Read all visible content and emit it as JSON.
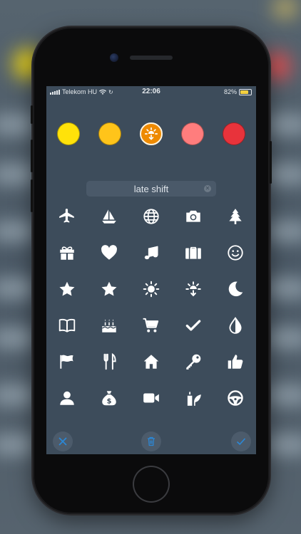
{
  "status_bar": {
    "carrier": "Telekom HU",
    "time": "22:06",
    "battery": "82%",
    "battery_level": 0.82
  },
  "colors": [
    {
      "name": "yellow",
      "hex": "#ffe20a",
      "selected": false
    },
    {
      "name": "amber",
      "hex": "#ffc41a",
      "selected": false
    },
    {
      "name": "orange",
      "hex": "#ee8a00",
      "selected": true
    },
    {
      "name": "salmon",
      "hex": "#ff7d7d",
      "selected": false
    },
    {
      "name": "red",
      "hex": "#e8333b",
      "selected": false
    }
  ],
  "shift_name": {
    "value": "late shift"
  },
  "icons": [
    [
      "airplane-icon",
      "sailboat-icon",
      "globe-icon",
      "camera-icon",
      "tree-icon"
    ],
    [
      "gift-icon",
      "heart-icon",
      "music-note-icon",
      "briefcase-icon",
      "smiley-icon"
    ],
    [
      "star-icon",
      "star-filled-icon",
      "sun-icon",
      "sunrise-icon",
      "moon-icon"
    ],
    [
      "book-icon",
      "birthday-cake-icon",
      "shopping-cart-icon",
      "checkmark-icon",
      "water-drop-icon"
    ],
    [
      "flag-icon",
      "fork-knife-icon",
      "home-icon",
      "key-icon",
      "thumbs-up-icon"
    ],
    [
      "person-icon",
      "money-bag-icon",
      "video-camera-icon",
      "candle-leaf-icon",
      "steering-wheel-icon"
    ]
  ],
  "toolbar": {
    "close": "close-icon",
    "delete": "trash-icon",
    "confirm": "checkmark-icon"
  }
}
